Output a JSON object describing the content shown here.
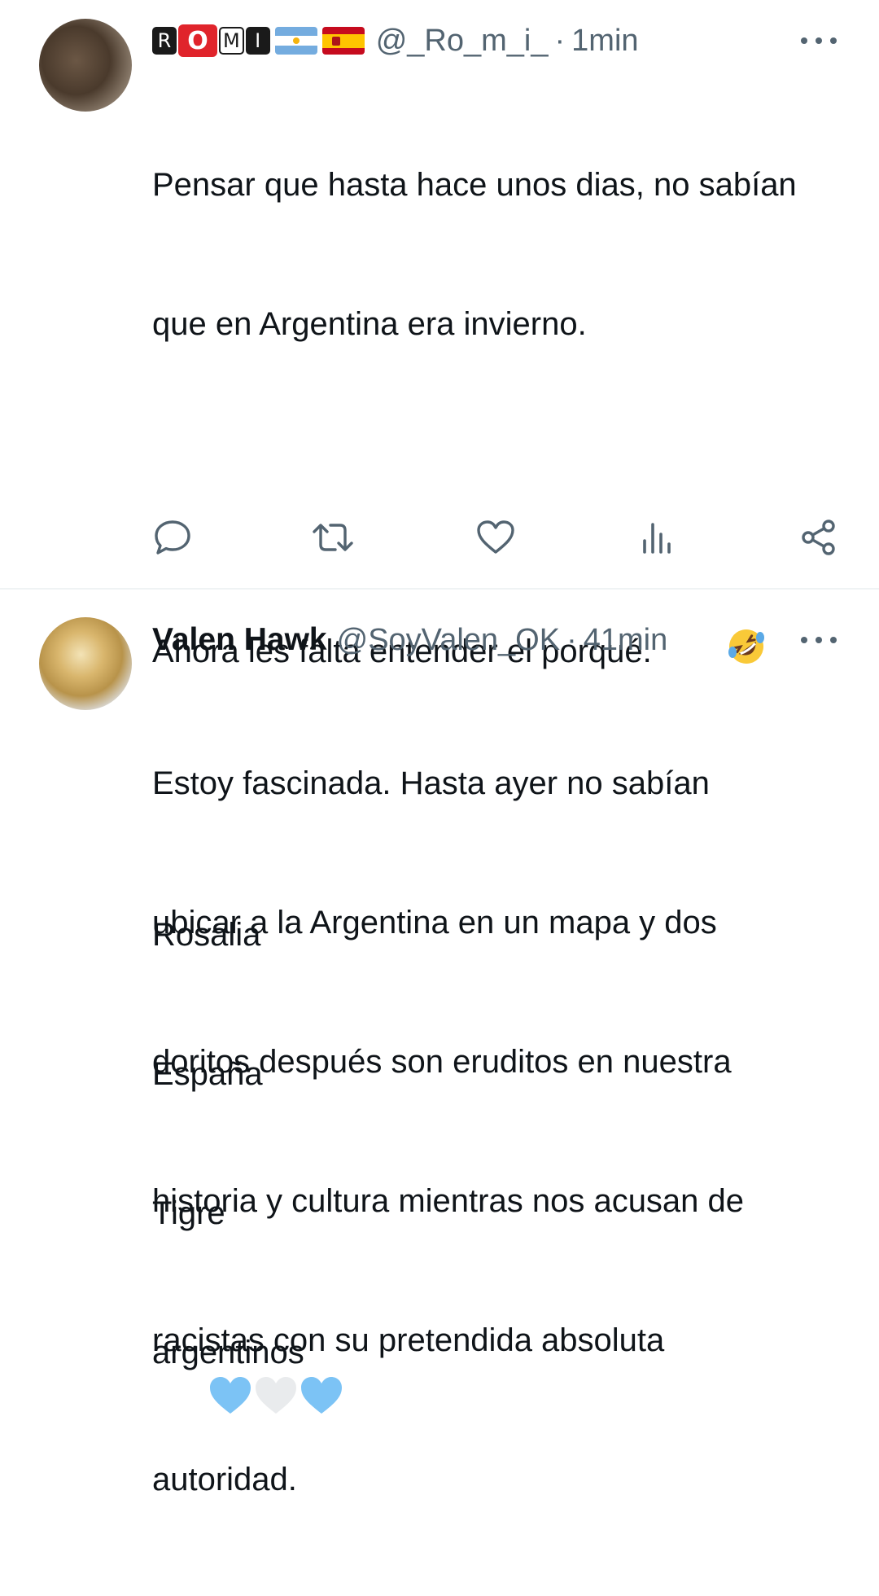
{
  "tweets": [
    {
      "badge_letters": [
        "R",
        "O",
        "M",
        "I"
      ],
      "handle": "@_Ro_m_i_",
      "separator": "·",
      "time": "1min",
      "lines": [
        "Pensar que hasta hace unos dias, no sabían",
        "que en Argentina era invierno.",
        "",
        "Ahora les falta entender el porqué.",
        "",
        "Rosalia",
        "España",
        "Tigre",
        "argentinos"
      ],
      "emoji": {
        "line_4": "rolling-on-floor-laughing",
        "line_9": [
          "light-blue-heart",
          "white-heart",
          "light-blue-heart"
        ]
      },
      "flags": [
        "argentina-flag",
        "spain-flag"
      ],
      "actions": [
        "reply-icon",
        "retweet-icon",
        "like-icon",
        "views-icon",
        "share-icon"
      ]
    },
    {
      "name": "Valen Hawk",
      "handle": "@SoyValen_OK",
      "separator": "·",
      "time": "41min",
      "lines": [
        "Estoy fascinada. Hasta ayer no sabían",
        "ubicar a la Argentina en un mapa y dos",
        "doritos después son eruditos en nuestra",
        "historia y cultura mientras nos acusan de",
        "racistas con su pretendida absoluta",
        "autoridad."
      ]
    }
  ],
  "colors": {
    "text": "#0f1419",
    "secondary": "#536471",
    "divider": "#eff3f4",
    "heart_blue": "#7cc3f5"
  }
}
